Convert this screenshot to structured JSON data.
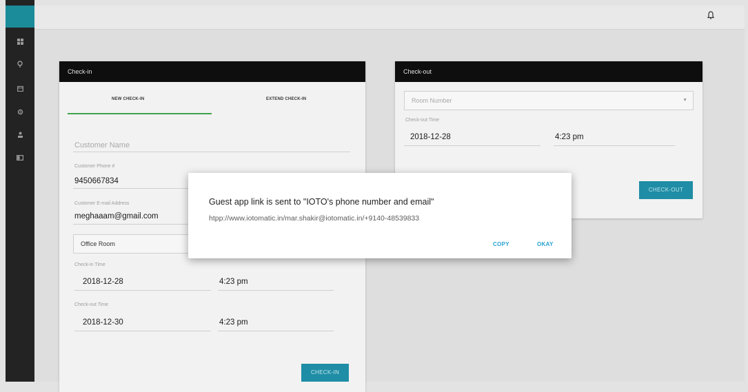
{
  "sidebar": {
    "icons": [
      "dashboard-icon",
      "location-icon",
      "calendar-icon",
      "settings-icon",
      "user-icon",
      "card-icon"
    ]
  },
  "header": {
    "icons": [
      "bell-icon"
    ]
  },
  "checkin": {
    "title": "Check-in",
    "tabs": [
      {
        "label": "NEW CHECK-IN",
        "active": true
      },
      {
        "label": "EXTEND CHECK-IN",
        "active": false
      }
    ],
    "customer_name_placeholder": "Customer Name",
    "phone_label": "Customer Phone #",
    "phone_value": "9450667834",
    "email_label": "Customer E-mail Address",
    "email_value": "meghaaam@gmail.com",
    "room_value": "Office Room",
    "checkin_time_label": "Check-in Time",
    "checkin_date": "2018-12-28",
    "checkin_time": "4:23 pm",
    "checkout_time_label": "Check-out Time",
    "checkout_date": "2018-12-30",
    "checkout_time": "4:23 pm",
    "submit_label": "CHECK-IN"
  },
  "checkout": {
    "title": "Check-out",
    "room_placeholder": "Room Number",
    "time_label": "Check-out Time",
    "date": "2018-12-28",
    "time": "4:23 pm",
    "submit_label": "CHECK-OUT"
  },
  "modal": {
    "title": "Guest app link is sent to \"IOTO's phone number and email\"",
    "link": "htpp://www.iotomatic.in/mar.shakir@iotomatic.in/+9140-48539833",
    "copy_label": "COPY",
    "okay_label": "OKAY"
  },
  "colors": {
    "accent": "#1f8da5",
    "active_tab": "#3ea34b",
    "modal_button": "#27a1d1",
    "card_header": "#0e0e0e"
  }
}
